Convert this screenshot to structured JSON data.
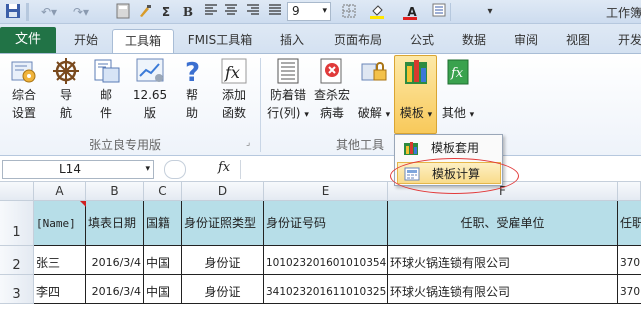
{
  "window": {
    "title": "工作簿"
  },
  "quick_access": {
    "icons": [
      "save-icon",
      "undo-icon",
      "redo-icon",
      "calc-icon",
      "brush-icon",
      "sum-icon",
      "bold-icon",
      "align-left-icon",
      "align-center-icon",
      "align-right-icon",
      "border-icon",
      "fill-color-icon",
      "font-color-icon",
      "list-icon",
      "more-icon"
    ],
    "sum_label": "Σ",
    "bold_label": "B",
    "font_color_label": "A",
    "font_size": "9"
  },
  "tabs": {
    "file": "文件",
    "items": [
      {
        "label": "开始"
      },
      {
        "label": "工具箱"
      },
      {
        "label": "FMIS工具箱"
      },
      {
        "label": "插入"
      },
      {
        "label": "页面布局"
      },
      {
        "label": "公式"
      },
      {
        "label": "数据"
      },
      {
        "label": "审阅"
      },
      {
        "label": "视图"
      },
      {
        "label": "开发"
      }
    ]
  },
  "ribbon": {
    "group1": {
      "label": "张立良专用版",
      "buttons": [
        {
          "line1": "综合",
          "line2": "设置",
          "icon": "settings-gear-icon"
        },
        {
          "line1": "导",
          "line2": "航",
          "icon": "helm-wheel-icon"
        },
        {
          "line1": "邮",
          "line2": "件",
          "icon": "mail-merge-icon"
        },
        {
          "line1": "12.65",
          "line2": "版",
          "icon": "version-chart-icon"
        },
        {
          "line1": "帮",
          "line2": "助",
          "icon": "help-icon"
        },
        {
          "line1": "添加",
          "line2": "函数",
          "icon": "function-fx-icon"
        }
      ]
    },
    "group2": {
      "label": "其他工具",
      "buttons": [
        {
          "line1": "防着错",
          "line2": "行(列)",
          "icon": "row-guard-icon"
        },
        {
          "line1": "查杀宏",
          "line2": "病毒",
          "icon": "macro-virus-icon"
        },
        {
          "line1": "",
          "line2": "破解",
          "icon": "crack-lock-icon"
        },
        {
          "line1": "",
          "line2": "模板",
          "icon": "template-icon"
        },
        {
          "line1": "",
          "line2": "其他",
          "icon": "other-fx-icon"
        }
      ]
    },
    "dropdown_arrow": "▾",
    "launcher_icon": "dialog-launcher-icon"
  },
  "formula_bar": {
    "cell_ref": "L14",
    "fx_label": "fx",
    "value": ""
  },
  "dropdown_menu": {
    "items": [
      {
        "label": "模板套用",
        "icon": "template-apply-icon"
      },
      {
        "label": "模板计算",
        "icon": "template-calc-icon"
      }
    ]
  },
  "sheet": {
    "columns": [
      "A",
      "B",
      "C",
      "D",
      "E",
      "F",
      ""
    ],
    "rows": [
      "1",
      "2",
      "3"
    ],
    "header_row": [
      "[Name]",
      "填表日期",
      "国籍",
      "身份证照类型",
      "身份证号码",
      "任职、受雇单位",
      "任职"
    ],
    "data_rows": [
      [
        "张三",
        "2016/3/4",
        "中国",
        "身份证",
        "101023201601010354",
        "环球火锅连锁有限公司",
        "3701"
      ],
      [
        "李四",
        "2016/3/4",
        "中国",
        "身份证",
        "341023201611010325",
        "环球火锅连锁有限公司",
        "3701"
      ]
    ]
  },
  "colors": {
    "file_tab": "#217346",
    "header_fill": "#b7dee8",
    "highlight": "#e23a3a"
  }
}
